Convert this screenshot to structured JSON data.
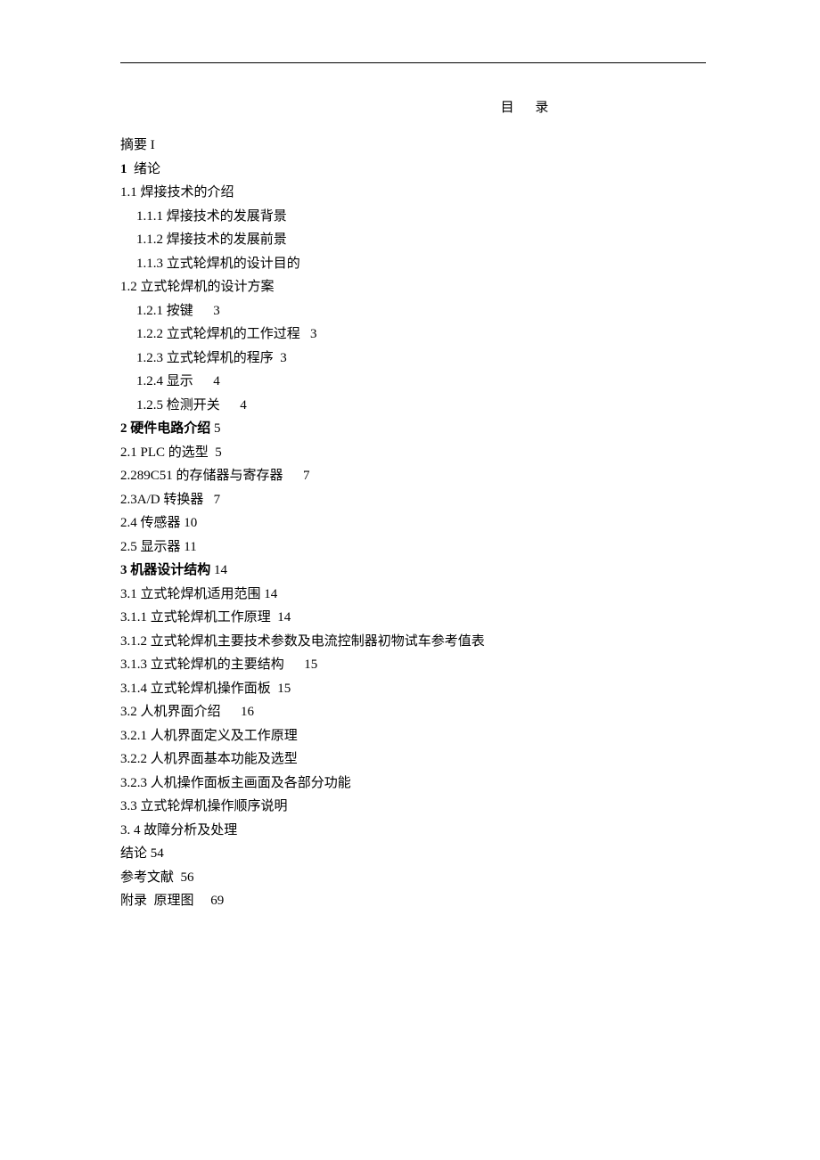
{
  "title": "目  录",
  "lines": [
    {
      "text": "摘要 I",
      "indent": 0,
      "bold": false
    },
    {
      "text": "1  绪论",
      "indent": 0,
      "boldPrefix": "1",
      "rest": "  绪论"
    },
    {
      "text": "1.1 焊接技术的介绍",
      "indent": 0,
      "bold": false
    },
    {
      "text": "1.1.1 焊接技术的发展背景",
      "indent": 1,
      "bold": false
    },
    {
      "text": "1.1.2 焊接技术的发展前景",
      "indent": 1,
      "bold": false
    },
    {
      "text": "1.1.3 立式轮焊机的设计目的",
      "indent": 1,
      "bold": false
    },
    {
      "text": "1.2 立式轮焊机的设计方案",
      "indent": 0,
      "bold": false
    },
    {
      "text": "1.2.1 按键      3",
      "indent": 1,
      "bold": false
    },
    {
      "text": "1.2.2 立式轮焊机的工作过程   3",
      "indent": 1,
      "bold": false
    },
    {
      "text": "1.2.3 立式轮焊机的程序  3",
      "indent": 1,
      "bold": false
    },
    {
      "text": "1.2.4 显示      4",
      "indent": 1,
      "bold": false
    },
    {
      "text": "1.2.5 检测开关      4",
      "indent": 1,
      "bold": false
    },
    {
      "text": "2 硬件电路介绍 5",
      "indent": 0,
      "boldPrefix": "2 硬件电路介绍",
      "rest": " 5"
    },
    {
      "text": "2.1 PLC 的选型  5",
      "indent": 0,
      "bold": false
    },
    {
      "text": "2.289C51 的存储器与寄存器      7",
      "indent": 0,
      "bold": false
    },
    {
      "text": "2.3A/D 转换器   7",
      "indent": 0,
      "bold": false
    },
    {
      "text": "2.4 传感器 10",
      "indent": 0,
      "bold": false
    },
    {
      "text": "2.5 显示器 11",
      "indent": 0,
      "bold": false
    },
    {
      "text": "3 机器设计结构 14",
      "indent": 0,
      "boldPrefix": "3 机器设计结构",
      "rest": " 14"
    },
    {
      "text": "3.1 立式轮焊机适用范围 14",
      "indent": 0,
      "bold": false
    },
    {
      "text": "3.1.1 立式轮焊机工作原理  14",
      "indent": 0,
      "bold": false
    },
    {
      "text": "3.1.2 立式轮焊机主要技术参数及电流控制器初物试车参考值表",
      "indent": 0,
      "bold": false
    },
    {
      "text": "3.1.3 立式轮焊机的主要结构      15",
      "indent": 0,
      "bold": false
    },
    {
      "text": "3.1.4 立式轮焊机操作面板  15",
      "indent": 0,
      "bold": false
    },
    {
      "text": "3.2 人机界面介绍      16",
      "indent": 0,
      "bold": false
    },
    {
      "text": "3.2.1 人机界面定义及工作原理",
      "indent": 0,
      "bold": false
    },
    {
      "text": "3.2.2 人机界面基本功能及选型",
      "indent": 0,
      "bold": false
    },
    {
      "text": "3.2.3 人机操作面板主画面及各部分功能",
      "indent": 0,
      "bold": false
    },
    {
      "text": "3.3 立式轮焊机操作顺序说明",
      "indent": 0,
      "bold": false
    },
    {
      "text": "3. 4 故障分析及处理",
      "indent": 0,
      "bold": false
    },
    {
      "text": "结论 54",
      "indent": 0,
      "bold": false
    },
    {
      "text": "参考文献  56",
      "indent": 0,
      "bold": false
    },
    {
      "text": "附录  原理图     69",
      "indent": 0,
      "bold": false
    }
  ]
}
